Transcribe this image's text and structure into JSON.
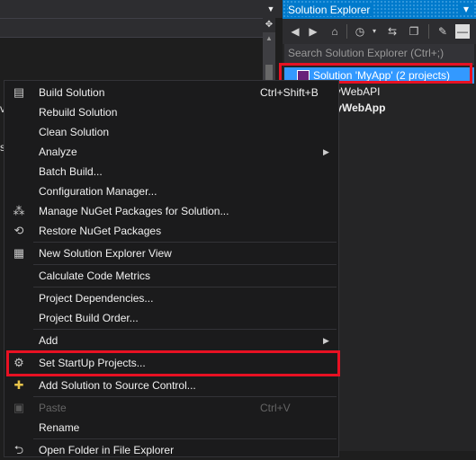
{
  "solution_explorer": {
    "title": "Solution Explorer",
    "search_placeholder": "Search Solution Explorer (Ctrl+;)",
    "tree": {
      "root": "Solution 'MyApp' (2 projects)",
      "projects": [
        "lyWebAPI",
        "lyWebApp"
      ]
    },
    "toolbar_icons": [
      "back-icon",
      "forward-icon",
      "home-icon",
      "history-icon",
      "sync-icon",
      "collapse-all-icon",
      "properties-icon",
      "minimize-icon"
    ]
  },
  "editor": {
    "behind_text": [
      "ve",
      "s"
    ]
  },
  "context_menu": {
    "items": [
      {
        "label": "Build Solution",
        "shortcut": "Ctrl+Shift+B",
        "icon": "build-icon"
      },
      {
        "label": "Rebuild Solution"
      },
      {
        "label": "Clean Solution"
      },
      {
        "label": "Analyze",
        "submenu": true
      },
      {
        "label": "Batch Build..."
      },
      {
        "label": "Configuration Manager..."
      },
      {
        "label": "Manage NuGet Packages for Solution...",
        "icon": "nuget-icon"
      },
      {
        "label": "Restore NuGet Packages",
        "icon": "restore-icon"
      },
      {
        "label": "New Solution Explorer View",
        "icon": "new-view-icon"
      },
      {
        "label": "Calculate Code Metrics"
      },
      {
        "label": "Project Dependencies..."
      },
      {
        "label": "Project Build Order..."
      },
      {
        "label": "Add",
        "submenu": true
      },
      {
        "label": "Set StartUp Projects...",
        "icon": "gear-icon"
      },
      {
        "label": "Add Solution to Source Control...",
        "icon": "source-control-icon"
      },
      {
        "label": "Paste",
        "shortcut": "Ctrl+V",
        "disabled": true,
        "icon": "paste-icon"
      },
      {
        "label": "Rename"
      },
      {
        "label": "Open Folder in File Explorer",
        "icon": "folder-icon"
      }
    ]
  },
  "colors": {
    "highlight_red": "#e81123",
    "accent_blue": "#007acc",
    "selection_blue": "#3399ff"
  }
}
